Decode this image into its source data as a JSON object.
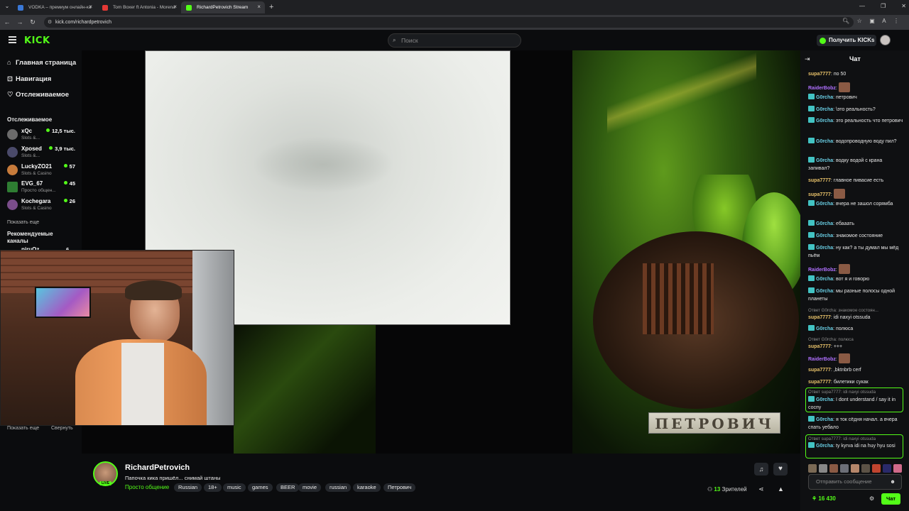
{
  "browser": {
    "tabs": [
      {
        "title": "VODKA – премиум онлайн-ка",
        "active": false
      },
      {
        "title": "Tom Boxer ft Antonia - Morena",
        "active": false
      },
      {
        "title": "RichardPetrovich Stream",
        "active": true
      }
    ],
    "url": "kick.com/richardpetrovich"
  },
  "header": {
    "logo": "KICK",
    "search_placeholder": "Поиск",
    "kicks_button": "Получить KICKs"
  },
  "sidebar": {
    "nav": [
      {
        "label": "Главная страница",
        "icon": "home-icon"
      },
      {
        "label": "Навигация",
        "icon": "compass-icon"
      },
      {
        "label": "Отслеживаемое",
        "icon": "heart-icon"
      }
    ],
    "following_title": "Отслеживаемое",
    "channels": [
      {
        "name": "xQc",
        "category": "Slots &...",
        "viewers": "12,5 тыс.",
        "color": "#6b6b6b"
      },
      {
        "name": "Xposed",
        "category": "Slots &...",
        "viewers": "3,9 тыс.",
        "color": "#4a4a6a"
      },
      {
        "name": "LuckyZO21",
        "category": "Slots & Casino",
        "viewers": "57",
        "color": "#c77b3b"
      },
      {
        "name": "EVG_67",
        "category": "Просто общен...",
        "viewers": "45",
        "color": "#2e7d32"
      },
      {
        "name": "Kochegara",
        "category": "Slots & Casino",
        "viewers": "26",
        "color": "#7a4d8a"
      }
    ],
    "show_more": "Показать еще",
    "recommended_title": "Рекомендуемые каналы",
    "recommended_partial": "piruQz",
    "recommended_partial_viewers": "6",
    "show_more_2": "Показать еще",
    "collapse": "Свернуть"
  },
  "player": {
    "overlay_text": "ПЕТРОВИЧ"
  },
  "stream": {
    "streamer": "RichardPetrovich",
    "title": "Папочка кика пришёл... снимай штаны",
    "category": "Просто общение",
    "live_badge": "LIVE",
    "tags": [
      "Russian",
      "18+",
      "music",
      "games",
      "BEER",
      "movie",
      "russian",
      "karaoke",
      "Петрович"
    ],
    "viewers_count": "13",
    "viewers_label": "Зрителей"
  },
  "chat": {
    "title": "Чат",
    "messages": [
      {
        "user": "supa7777",
        "text": "по 50",
        "color": "#e8c26a",
        "badge": false,
        "emote": false
      },
      {
        "user": "RaiderBobz",
        "text": "",
        "color": "#b070ff",
        "badge": false,
        "emote": true
      },
      {
        "user": "G0rcha",
        "text": "петрович",
        "color": "#6ad0e6",
        "badge": true,
        "emote": false
      },
      {
        "user": "G0rcha",
        "text": "\\это реальность?",
        "color": "#6ad0e6",
        "badge": true,
        "emote": false
      },
      {
        "user": "G0rcha",
        "text": "это реальность что петрович",
        "color": "#6ad0e6",
        "badge": true,
        "emote": false
      },
      {
        "user": "G0rcha",
        "text": "водопроводную воду пил?",
        "color": "#6ad0e6",
        "badge": true,
        "emote": false
      },
      {
        "user": "G0rcha",
        "text": "водку водой с крана запивал?",
        "color": "#6ad0e6",
        "badge": true,
        "emote": false
      },
      {
        "user": "supa7777",
        "text": "главное пивасие есть",
        "color": "#e8c26a",
        "badge": false,
        "emote": false
      },
      {
        "user": "supa7777",
        "text": "",
        "color": "#e8c26a",
        "badge": false,
        "emote": true
      },
      {
        "user": "G0rcha",
        "text": "вчера не зашол сорямба",
        "color": "#6ad0e6",
        "badge": true,
        "emote": false
      },
      {
        "user": "G0rcha",
        "text": "ебааать",
        "color": "#6ad0e6",
        "badge": true,
        "emote": false
      },
      {
        "user": "G0rcha",
        "text": "знакомое состояние",
        "color": "#6ad0e6",
        "badge": true,
        "emote": false
      },
      {
        "user": "G0rcha",
        "text": "ну как? а ты думал мы мёд пьём",
        "color": "#6ad0e6",
        "badge": true,
        "emote": false
      },
      {
        "user": "RaiderBobz",
        "text": "",
        "color": "#b070ff",
        "badge": false,
        "emote": true
      },
      {
        "user": "G0rcha",
        "text": "вот я и говорю",
        "color": "#6ad0e6",
        "badge": true,
        "emote": false
      },
      {
        "user": "G0rcha",
        "text": "мы разные полосы одной планеты",
        "color": "#6ad0e6",
        "badge": true,
        "emote": false
      }
    ],
    "reply1": "Ответ G0rcha: знакомое состоян...",
    "msg_r1": {
      "user": "supa7777",
      "text": "idi naxyi otssuda"
    },
    "msg_r2": {
      "user": "G0rcha",
      "text": "полюса"
    },
    "reply2": "Ответ G0rcha: полюса",
    "msg_r3": {
      "user": "supa7777",
      "text": "+++"
    },
    "msg_r4": {
      "user": "RaiderBobz",
      "text": ""
    },
    "msg_r5": {
      "user": "supa7777",
      "text": ",bktnbrb cerf"
    },
    "msg_r6": {
      "user": "supa7777",
      "text": "билетики сукак"
    },
    "reply3": "Ответ supa7777: idi naxyi otssuda",
    "msg_r7": {
      "user": "G0rcha",
      "text": "I dont understand / say it in соспу"
    },
    "msg_r8": {
      "user": "G0rcha",
      "text": "я ток сёдня начал. а вчера спать уебало"
    },
    "reply4": "Ответ supa7777: idi naxyi otssuda",
    "msg_r9": {
      "user": "G0rcha",
      "text": "ty kyrva idi na huy hyu sosi"
    },
    "input_placeholder": "Отправить сообщение",
    "kicks_balance": "16 430",
    "send_button": "Чат"
  }
}
